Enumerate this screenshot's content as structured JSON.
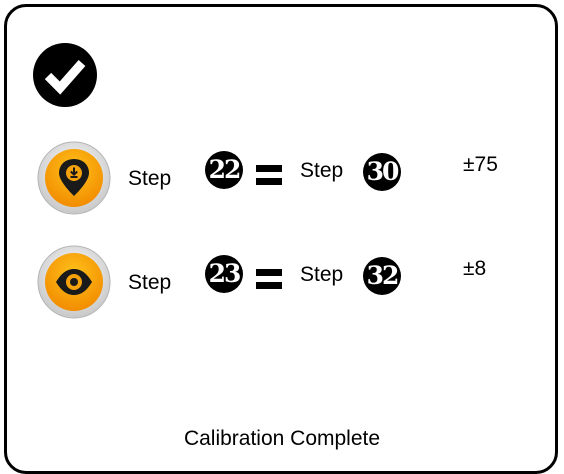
{
  "icons": {
    "status": "check-circle-icon",
    "row1": "location-pin-download-icon",
    "row2": "eye-icon"
  },
  "colors": {
    "accent": "#f9a30f",
    "badge": "#000000"
  },
  "rows": [
    {
      "step_label_a": "Step",
      "step_num_a": "22",
      "step_label_b": "Step",
      "step_num_b": "30",
      "tolerance": "±75"
    },
    {
      "step_label_a": "Step",
      "step_num_a": "23",
      "step_label_b": "Step",
      "step_num_b": "32",
      "tolerance": "±8"
    }
  ],
  "status": {
    "text": "Calibration Complete"
  }
}
